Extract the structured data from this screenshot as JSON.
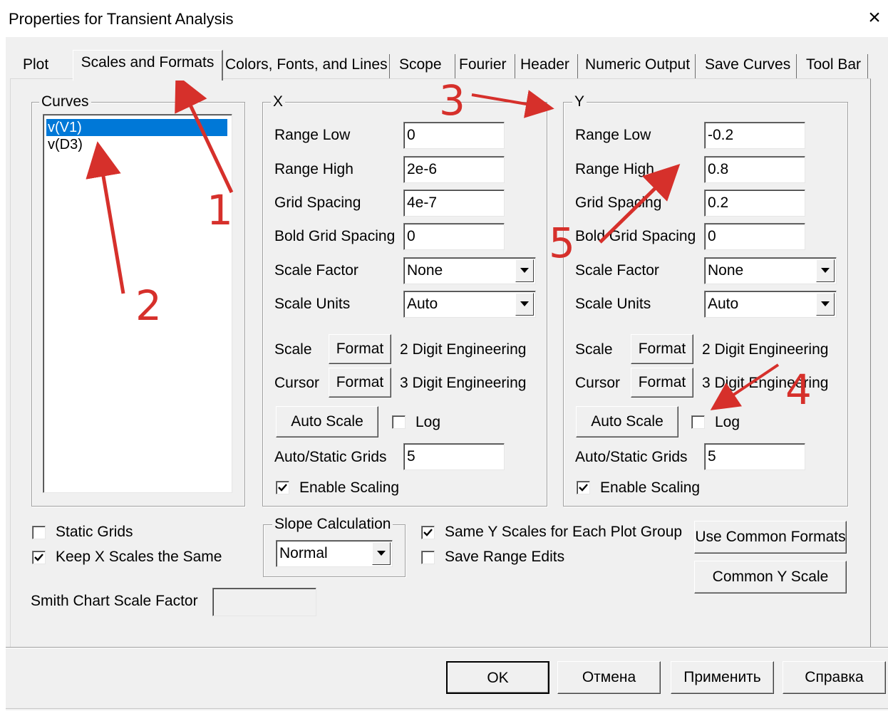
{
  "window": {
    "title": "Properties for Transient Analysis",
    "close_glyph": "×"
  },
  "tabs": [
    "Plot",
    "Scales and Formats",
    "Colors, Fonts, and Lines",
    "Scope",
    "Fourier",
    "Header",
    "Numeric Output",
    "Save Curves",
    "Tool Bar"
  ],
  "curves": {
    "label": "Curves",
    "items": [
      "v(V1)",
      "v(D3)"
    ],
    "selected": "v(V1)"
  },
  "x": {
    "label": "X",
    "range_low_label": "Range Low",
    "range_low": "0",
    "range_high_label": "Range High",
    "range_high": "2e-6",
    "grid_spacing_label": "Grid Spacing",
    "grid_spacing": "4e-7",
    "bold_grid_label": "Bold Grid Spacing",
    "bold_grid": "0",
    "scale_factor_label": "Scale Factor",
    "scale_factor": "None",
    "scale_units_label": "Scale Units",
    "scale_units": "Auto",
    "scale_label": "Scale",
    "scale_format_btn": "Format",
    "scale_format": "2 Digit Engineering",
    "cursor_label": "Cursor",
    "cursor_format_btn": "Format",
    "cursor_format": "3 Digit Engineering",
    "auto_scale_btn": "Auto Scale",
    "log_label": "Log",
    "log_checked": false,
    "auto_static_label": "Auto/Static Grids",
    "auto_static": "5",
    "enable_scaling_label": "Enable Scaling",
    "enable_scaling": true
  },
  "y": {
    "label": "Y",
    "range_low_label": "Range Low",
    "range_low": "-0.2",
    "range_high_label": "Range High",
    "range_high": "0.8",
    "grid_spacing_label": "Grid Spacing",
    "grid_spacing": "0.2",
    "bold_grid_label": "Bold Grid Spacing",
    "bold_grid": "0",
    "scale_factor_label": "Scale Factor",
    "scale_factor": "None",
    "scale_units_label": "Scale Units",
    "scale_units": "Auto",
    "scale_label": "Scale",
    "scale_format_btn": "Format",
    "scale_format": "2 Digit Engineering",
    "cursor_label": "Cursor",
    "cursor_format_btn": "Format",
    "cursor_format": "3 Digit Engineering",
    "auto_scale_btn": "Auto Scale",
    "log_label": "Log",
    "log_checked": false,
    "auto_static_label": "Auto/Static Grids",
    "auto_static": "5",
    "enable_scaling_label": "Enable Scaling",
    "enable_scaling": true
  },
  "options": {
    "static_grids_label": "Static Grids",
    "static_grids": false,
    "keep_x_label": "Keep X Scales the Same",
    "keep_x": true,
    "smith_label": "Smith Chart Scale Factor",
    "smith_value": "",
    "slope_label": "Slope Calculation",
    "slope_value": "Normal",
    "same_y_label": "Same Y Scales for Each Plot Group",
    "same_y": true,
    "save_range_label": "Save Range Edits",
    "save_range": false,
    "use_common_btn": "Use Common Formats",
    "common_y_btn": "Common Y Scale"
  },
  "footer": {
    "ok": "OK",
    "cancel": "Отмена",
    "apply": "Применить",
    "help": "Справка"
  },
  "annotations": {
    "color": "#d6302b",
    "numbers": [
      "1",
      "2",
      "3",
      "4",
      "5"
    ]
  }
}
